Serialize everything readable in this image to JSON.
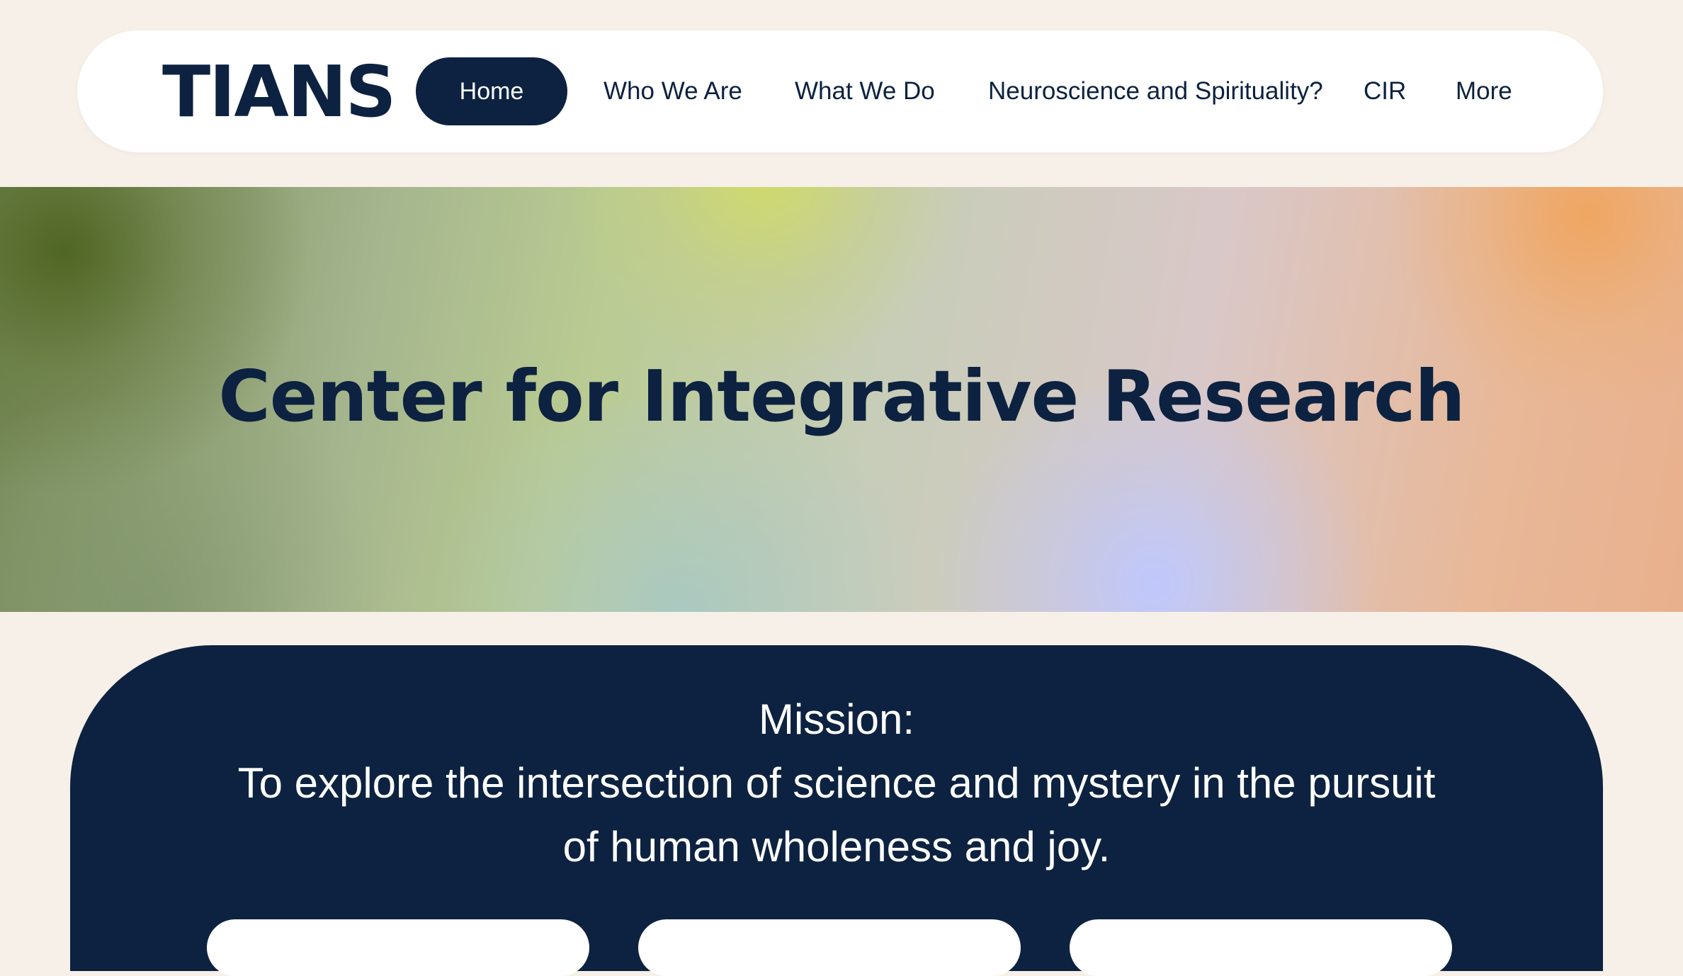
{
  "header": {
    "logo": "TIANS",
    "nav": {
      "home": "Home",
      "who_we_are": "Who We Are",
      "what_we_do": "What We Do",
      "neuro_spirit": "Neuroscience and Spirituality?",
      "cir": "CIR",
      "more": "More"
    }
  },
  "hero": {
    "title": "Center for Integrative Research"
  },
  "mission": {
    "heading": "Mission:",
    "body": "To explore the intersection of science and mystery in the pursuit of human wholeness and joy."
  },
  "colors": {
    "navy": "#0d2240",
    "page_bg": "#f6f0e8",
    "white": "#ffffff"
  }
}
